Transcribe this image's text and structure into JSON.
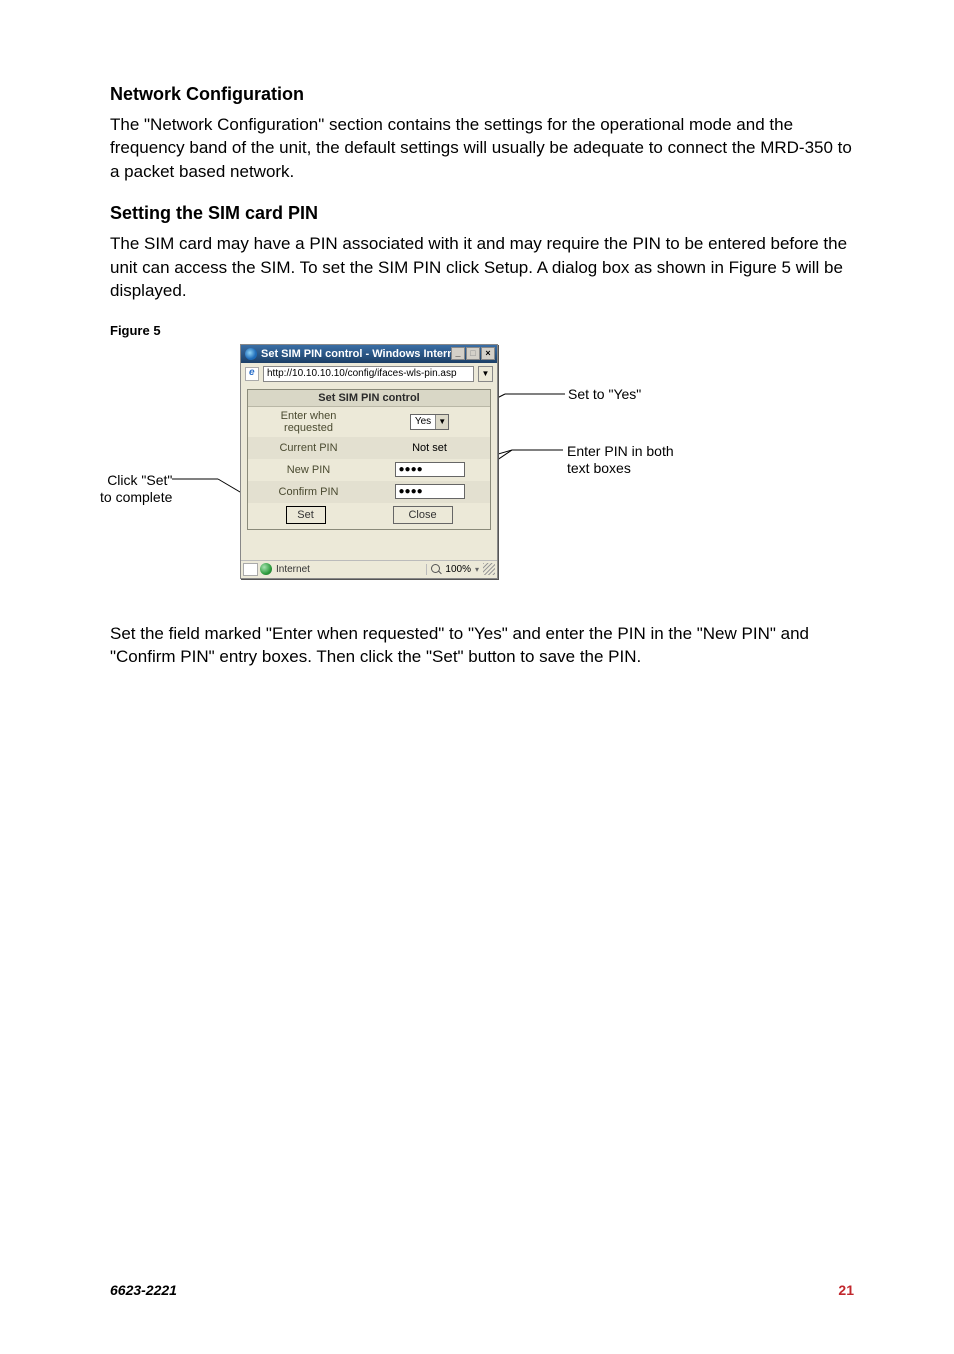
{
  "section1": {
    "heading": "Network Configuration",
    "text": "The \"Network Configuration\" section contains the settings for the operational mode and the frequency band of the unit, the default settings will usually be adequate to connect the MRD-350 to a packet based network."
  },
  "section2": {
    "heading": "Setting the SIM card PIN",
    "text": "The SIM card may have a PIN associated with it and may require the PIN to be entered before the unit can access the SIM. To set the SIM PIN click Setup. A dialog box as shown in Figure 5 will be displayed."
  },
  "figure_label": "Figure 5",
  "callouts": {
    "set_to_yes": "Set to \"Yes\"",
    "enter_pin": "Enter PIN in both text boxes",
    "click_set": "Click \"Set\" to complete"
  },
  "dialog": {
    "title": "Set SIM PIN control - Windows Internet...",
    "title_min": "_",
    "title_max": "□",
    "title_close": "×",
    "url": "http://10.10.10.10/config/ifaces-wls-pin.asp",
    "url_drop": "▼",
    "panel_title": "Set SIM PIN control",
    "rows": {
      "enter_when_label": "Enter when requested",
      "enter_when_value": "Yes",
      "enter_when_drop": "▼",
      "current_pin_label": "Current PIN",
      "current_pin_value": "Not set",
      "new_pin_label": "New PIN",
      "new_pin_value": "●●●●",
      "confirm_pin_label": "Confirm PIN",
      "confirm_pin_value": "●●●●"
    },
    "buttons": {
      "set": "Set",
      "close": "Close"
    },
    "status": {
      "zone": "Internet",
      "zoom": "100%",
      "zoom_drop": "▾"
    }
  },
  "section3": {
    "text": "Set the field marked \"Enter when requested\" to \"Yes\" and enter the PIN in the \"New PIN\" and \"Confirm PIN\" entry boxes. Then click the \"Set\" button to save the PIN."
  },
  "footer": {
    "doc_id": "6623-2221",
    "page": "21"
  }
}
